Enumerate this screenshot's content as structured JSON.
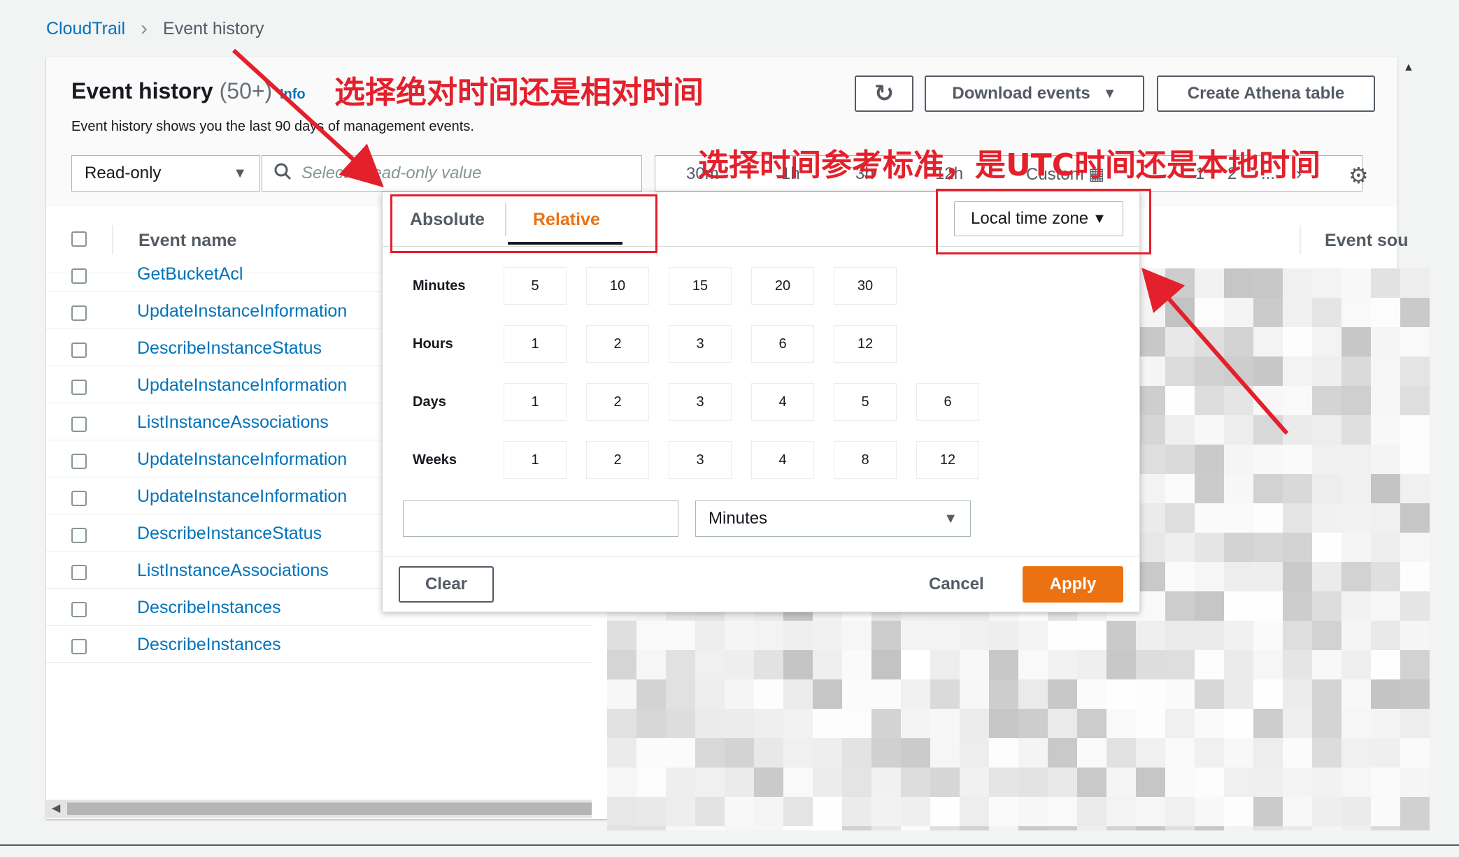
{
  "breadcrumb": {
    "root": "CloudTrail",
    "separator": ">",
    "current": "Event history"
  },
  "header": {
    "title": "Event history",
    "count": "(50+)",
    "info": "Info",
    "description": "Event history shows you the last 90 days of management events.",
    "download_label": "Download events",
    "athena_label": "Create Athena table"
  },
  "filter": {
    "attribute": "Read-only",
    "search_placeholder": "Select a read-only value",
    "ranges": [
      "30m",
      "1h",
      "3h",
      "12h",
      "Custom"
    ],
    "pages": [
      "1",
      "2",
      "..."
    ]
  },
  "table": {
    "col_name": "Event name",
    "col_source": "Event sou",
    "rows": [
      "GetBucketAcl",
      "UpdateInstanceInformation",
      "DescribeInstanceStatus",
      "UpdateInstanceInformation",
      "ListInstanceAssociations",
      "UpdateInstanceInformation",
      "UpdateInstanceInformation",
      "DescribeInstanceStatus",
      "ListInstanceAssociations",
      "DescribeInstances",
      "DescribeInstances"
    ]
  },
  "popover": {
    "tab_absolute": "Absolute",
    "tab_relative": "Relative",
    "timezone": "Local time zone",
    "groups": [
      {
        "label": "Minutes",
        "options": [
          "5",
          "10",
          "15",
          "20",
          "30"
        ]
      },
      {
        "label": "Hours",
        "options": [
          "1",
          "2",
          "3",
          "6",
          "12"
        ]
      },
      {
        "label": "Days",
        "options": [
          "1",
          "2",
          "3",
          "4",
          "5",
          "6"
        ]
      },
      {
        "label": "Weeks",
        "options": [
          "1",
          "2",
          "3",
          "4",
          "8",
          "12"
        ]
      }
    ],
    "unit": "Minutes",
    "clear_label": "Clear",
    "cancel_label": "Cancel",
    "apply_label": "Apply"
  },
  "annotations": {
    "note1": "选择绝对时间还是相对时间",
    "note2": "选择时间参考标准，是UTC时间还是本地时间"
  },
  "colors": {
    "link": "#0073bb",
    "accent": "#ec7211",
    "annotation": "#e3202b"
  },
  "icons": [
    "refresh-icon",
    "caret-down-icon",
    "search-icon",
    "calendar-icon",
    "gear-icon",
    "chevron-right-icon"
  ]
}
